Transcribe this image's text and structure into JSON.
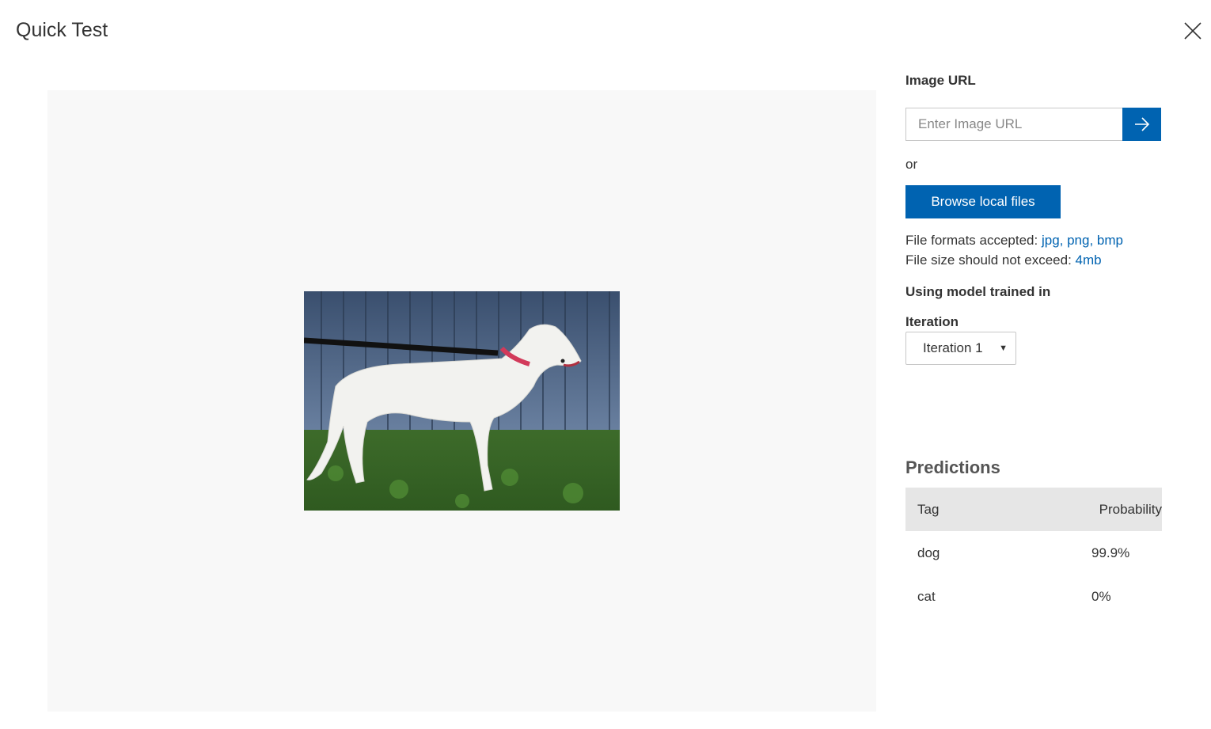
{
  "dialog": {
    "title": "Quick Test",
    "close_icon": "close-icon"
  },
  "image_url": {
    "label": "Image URL",
    "placeholder": "Enter Image URL",
    "value": "",
    "submit_icon": "arrow-right-icon"
  },
  "or_text": "or",
  "browse_label": "Browse local files",
  "file_info": {
    "formats_prefix": "File formats accepted: ",
    "formats_value": "jpg, png, bmp",
    "size_prefix": "File size should not exceed: ",
    "size_value": "4mb"
  },
  "model": {
    "label": "Using model trained in",
    "iteration_label": "Iteration",
    "iteration_selected": "Iteration 1"
  },
  "predictions": {
    "title": "Predictions",
    "columns": [
      "Tag",
      "Probability"
    ],
    "rows": [
      {
        "tag": "dog",
        "probability": "99.9%"
      },
      {
        "tag": "cat",
        "probability": "0%"
      }
    ]
  },
  "colors": {
    "accent": "#0063b1",
    "preview_bg": "#f8f8f8",
    "table_header_bg": "#e6e6e6"
  }
}
